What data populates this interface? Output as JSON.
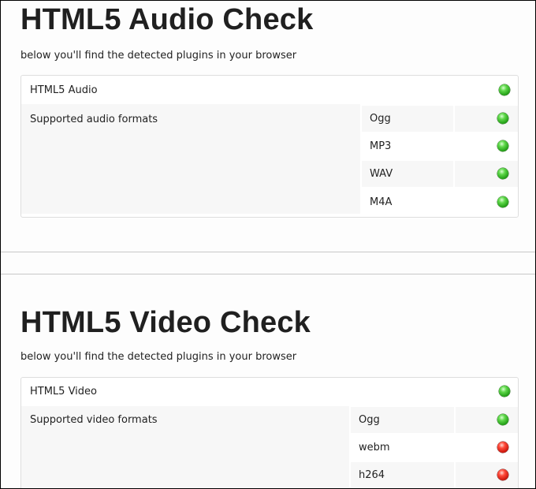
{
  "audio": {
    "title": "HTML5 Audio Check",
    "subtitle": "below you'll find the detected plugins in your browser",
    "main_label": "HTML5 Audio",
    "main_status": "green",
    "formats_label": "Supported audio formats",
    "formats": [
      {
        "name": "Ogg",
        "status": "green"
      },
      {
        "name": "MP3",
        "status": "green"
      },
      {
        "name": "WAV",
        "status": "green"
      },
      {
        "name": "M4A",
        "status": "green"
      }
    ]
  },
  "video": {
    "title": "HTML5 Video Check",
    "subtitle": "below you'll find the detected plugins in your browser",
    "main_label": "HTML5 Video",
    "main_status": "green",
    "formats_label": "Supported video formats",
    "formats": [
      {
        "name": "Ogg",
        "status": "green"
      },
      {
        "name": "webm",
        "status": "red"
      },
      {
        "name": "h264",
        "status": "red"
      }
    ]
  },
  "colors": {
    "supported": "#22aa14",
    "unsupported": "#d01208"
  }
}
